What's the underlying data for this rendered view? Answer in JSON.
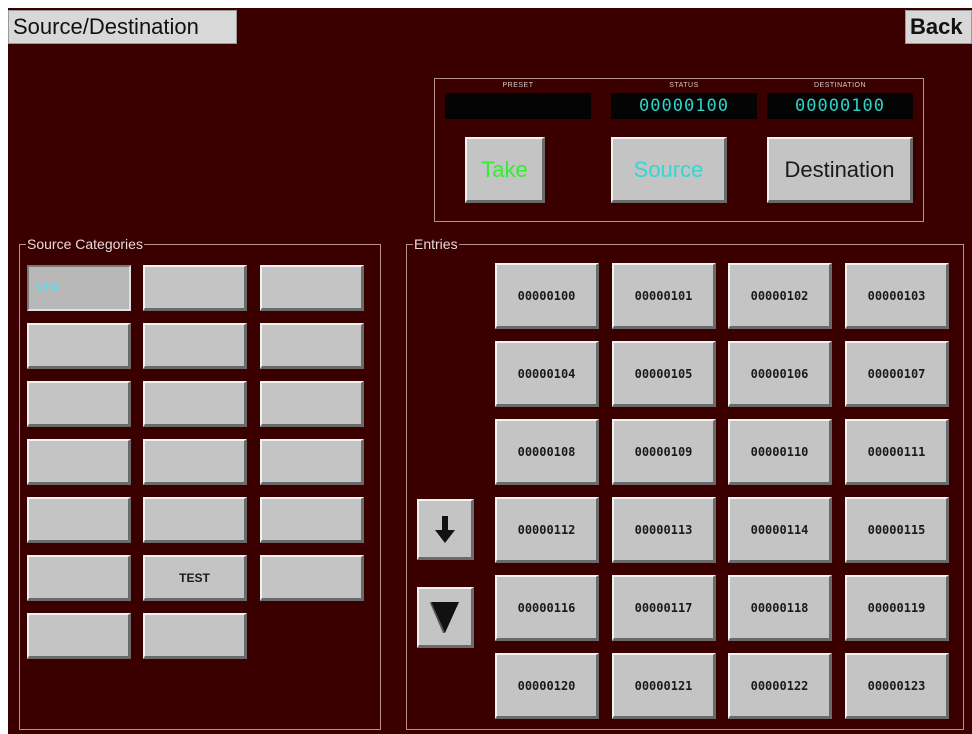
{
  "header": {
    "title": "Source/Destination",
    "back_label": "Back"
  },
  "status_panel": {
    "preset_label": "PRESET",
    "status_label": "STATUS",
    "destination_label": "DESTINATION",
    "preset_value": "",
    "status_value": "00000100",
    "destination_value": "00000100",
    "take_label": "Take",
    "source_label": "Source",
    "destination_button_label": "Destination",
    "colors": {
      "take": "#33ee33",
      "source": "#33d6d6",
      "display_text": "#2ed3c8"
    }
  },
  "source_categories": {
    "label": "Source Categories",
    "buttons": [
      "VTR",
      "",
      "",
      "",
      "",
      "",
      "",
      "",
      "",
      "",
      "",
      "",
      "",
      "",
      "",
      "",
      "TEST",
      "",
      "",
      ""
    ],
    "selected_color": "#6ad6e6"
  },
  "entries": {
    "label": "Entries",
    "items": [
      "00000100",
      "00000101",
      "00000102",
      "00000103",
      "00000104",
      "00000105",
      "00000106",
      "00000107",
      "00000108",
      "00000109",
      "00000110",
      "00000111",
      "00000112",
      "00000113",
      "00000114",
      "00000115",
      "00000116",
      "00000117",
      "00000118",
      "00000119",
      "00000120",
      "00000121",
      "00000122",
      "00000123"
    ],
    "scroll_icons": [
      "arrow-down-icon",
      "triangle-down-icon"
    ]
  }
}
